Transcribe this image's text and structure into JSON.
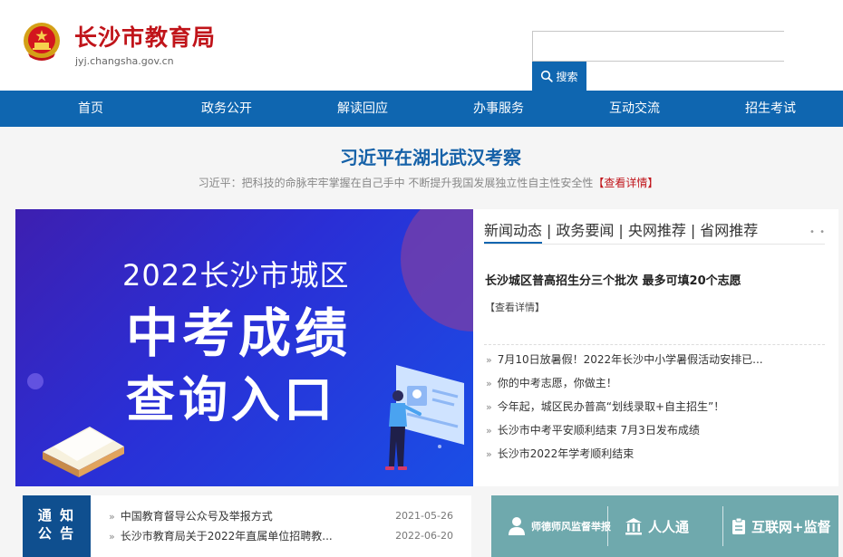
{
  "header": {
    "site_title": "长沙市教育局",
    "site_domain": "jyj.changsha.gov.cn",
    "search_placeholder": "",
    "search_label": "搜索"
  },
  "nav": {
    "items": [
      "首页",
      "政务公开",
      "解读回应",
      "办事服务",
      "互动交流",
      "招生考试"
    ]
  },
  "headline": {
    "title": "习近平在湖北武汉考察",
    "summary": "习近平：把科技的命脉牢牢掌握在自己手中 不断提升我国发展独立性自主性安全性",
    "more": "【查看详情】"
  },
  "banner": {
    "line1": "2022长沙市城区",
    "line2": "中考成绩",
    "line3": "查询入口"
  },
  "news": {
    "tabs": [
      "新闻动态",
      "政务要闻",
      "央网推荐",
      "省网推荐"
    ],
    "dots": "• •",
    "feature_title": "长沙城区普高招生分三个批次 最多可填20个志愿",
    "feature_more": "【查看详情】",
    "bullet": "»",
    "items": [
      "7月10日放暑假！2022年长沙中小学暑假活动安排已...",
      "你的中考志愿，你做主！",
      "今年起，城区民办普高“划线录取+自主招生”！",
      "长沙市中考平安顺利结束 7月3日发布成绩",
      "长沙市2022年学考顺利结束"
    ]
  },
  "notice": {
    "label_line1": "通 知",
    "label_line2": "公 告",
    "items": [
      {
        "title": "中国教育督导公众号及举报方式",
        "date": "2021-05-26"
      },
      {
        "title": "长沙市教育局关于2022年直属单位招聘教...",
        "date": "2022-06-20"
      }
    ]
  },
  "services": {
    "items": [
      "师德师风监督举报",
      "人人通",
      "互联网+监督"
    ]
  },
  "colors": {
    "brand_blue": "#0f66b0",
    "title_red": "#c0141a",
    "headline_blue": "#1561a8",
    "service_teal": "#6fa9ad"
  }
}
